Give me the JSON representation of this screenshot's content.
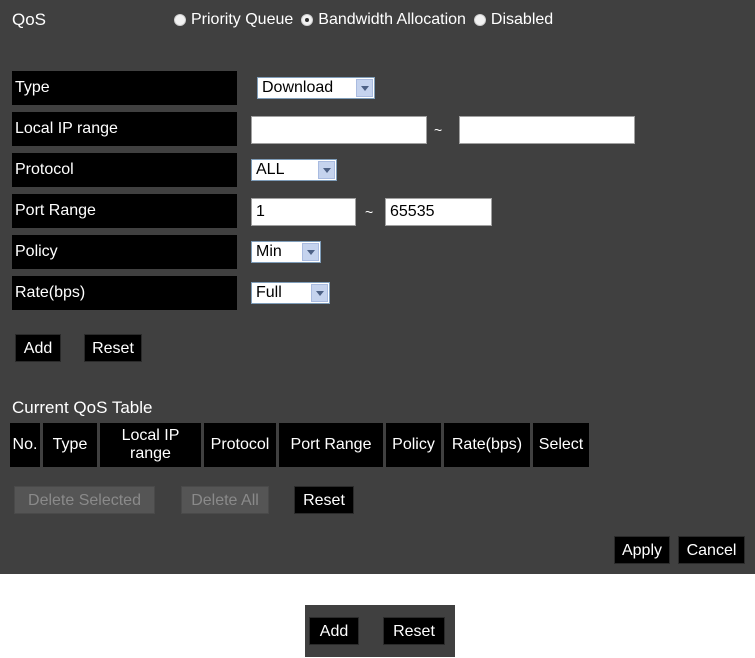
{
  "qos": {
    "title": "QoS",
    "options": [
      "Priority Queue",
      "Bandwidth Allocation",
      "Disabled"
    ],
    "selected": "Bandwidth Allocation"
  },
  "form": {
    "type_label": "Type",
    "type_value": "Download",
    "ip_label": "Local IP range",
    "ip_from": "",
    "ip_to": "",
    "range_sep": "~",
    "protocol_label": "Protocol",
    "protocol_value": "ALL",
    "port_label": "Port Range",
    "port_from": "1",
    "port_to": "65535",
    "policy_label": "Policy",
    "policy_value": "Min",
    "rate_label": "Rate(bps)",
    "rate_value": "Full"
  },
  "form_buttons": {
    "add": "Add",
    "reset": "Reset"
  },
  "table": {
    "title": "Current QoS Table",
    "headers": [
      "No.",
      "Type",
      "Local IP range",
      "Protocol",
      "Port Range",
      "Policy",
      "Rate(bps)",
      "Select"
    ]
  },
  "table_buttons": {
    "delete_selected": "Delete Selected",
    "delete_all": "Delete All",
    "reset": "Reset"
  },
  "footer_buttons": {
    "apply": "Apply",
    "cancel": "Cancel"
  },
  "detail_buttons": {
    "add": "Add",
    "reset": "Reset"
  }
}
